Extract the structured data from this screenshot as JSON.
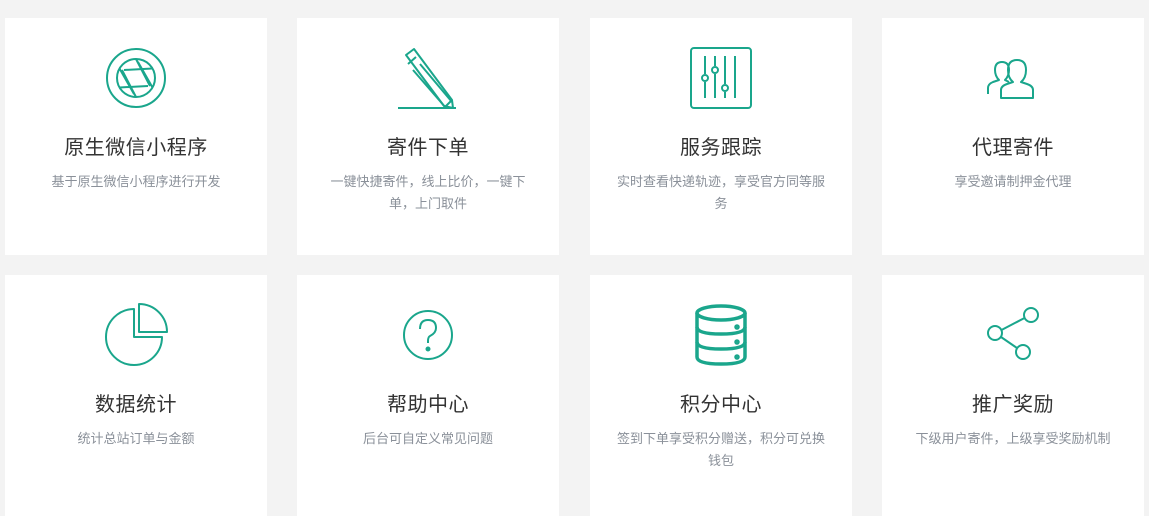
{
  "colors": {
    "accent": "#1aa68c",
    "background": "#f3f3f3",
    "card": "#ffffff",
    "title": "#333333",
    "desc": "#8a9099"
  },
  "features": [
    {
      "icon": "aperture-icon",
      "title": "原生微信小程序",
      "desc": "基于原生微信小程序进行开发"
    },
    {
      "icon": "pencil-icon",
      "title": "寄件下单",
      "desc": "一键快捷寄件，线上比价，一键下单，上门取件"
    },
    {
      "icon": "sliders-icon",
      "title": "服务跟踪",
      "desc": "实时查看快递轨迹，享受官方同等服务"
    },
    {
      "icon": "users-icon",
      "title": "代理寄件",
      "desc": "享受邀请制押金代理"
    },
    {
      "icon": "pie-chart-icon",
      "title": "数据统计",
      "desc": "统计总站订单与金额"
    },
    {
      "icon": "question-icon",
      "title": "帮助中心",
      "desc": "后台可自定义常见问题"
    },
    {
      "icon": "database-icon",
      "title": "积分中心",
      "desc": "签到下单享受积分赠送，积分可兑换钱包"
    },
    {
      "icon": "share-icon",
      "title": "推广奖励",
      "desc": "下级用户寄件，上级享受奖励机制"
    }
  ]
}
